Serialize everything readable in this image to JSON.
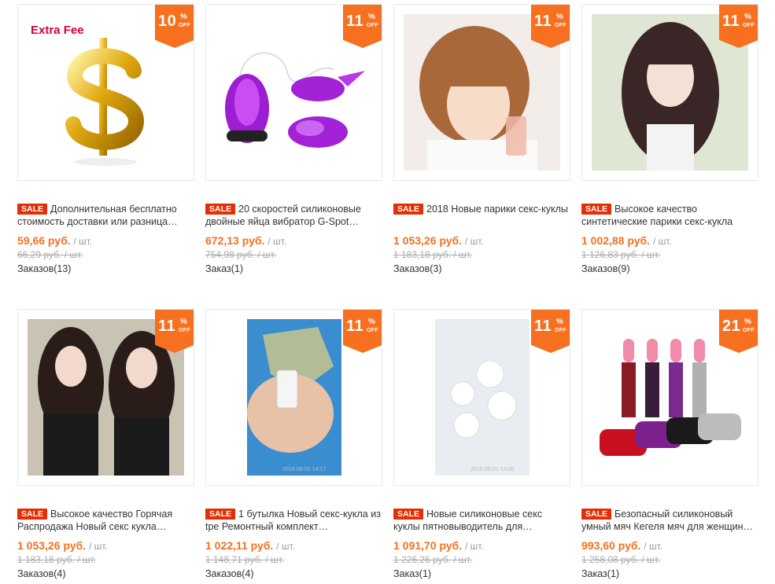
{
  "badge_off_text": "OFF",
  "badge_pct_text": "%",
  "sale_label": "SALE",
  "unit_label": "/ шт.",
  "old_unit_label": "/ шт.",
  "products": [
    {
      "discount": "10",
      "title": "Дополнительная бесплатно стоимость доставки или разница…",
      "price": "59,66 руб.",
      "old_price": "66,29 руб.",
      "orders": "Заказов(13)",
      "image_text": "Extra Fee"
    },
    {
      "discount": "11",
      "title": "20 скоростей силиконовые двойные яйца вибратор G-Spot…",
      "price": "672,13 руб.",
      "old_price": "754,98 руб.",
      "orders": "Заказ(1)"
    },
    {
      "discount": "11",
      "title": "2018 Новые парики секс-куклы",
      "price": "1 053,26 руб.",
      "old_price": "1 183,18 руб.",
      "orders": "Заказов(3)"
    },
    {
      "discount": "11",
      "title": "Высокое качество синтетические парики секс-кукла",
      "price": "1 002,88 руб.",
      "old_price": "1 126,83 руб.",
      "orders": "Заказов(9)"
    },
    {
      "discount": "11",
      "title": "Высокое качество Горячая Распродажа Новый секс кукла…",
      "price": "1 053,26 руб.",
      "old_price": "1 183,18 руб.",
      "orders": "Заказов(4)"
    },
    {
      "discount": "11",
      "title": "1 бутылка Новый секс-кукла из tpe Ремонтный комплект…",
      "price": "1 022,11 руб.",
      "old_price": "1 148,71 руб.",
      "orders": "Заказов(4)",
      "image_text": "2016-09-01 14:17"
    },
    {
      "discount": "11",
      "title": "Новые силиконовые секс куклы пятновыводитель для…",
      "price": "1 091,70 руб.",
      "old_price": "1 226,26 руб.",
      "orders": "Заказ(1)",
      "image_text": "2016-09-01 14:06"
    },
    {
      "discount": "21",
      "title": "Безопасный силиконовый умный мяч Кегеля мяч для женщин…",
      "price": "993,60 руб.",
      "old_price": "1 258,08 руб.",
      "orders": "Заказ(1)"
    }
  ]
}
